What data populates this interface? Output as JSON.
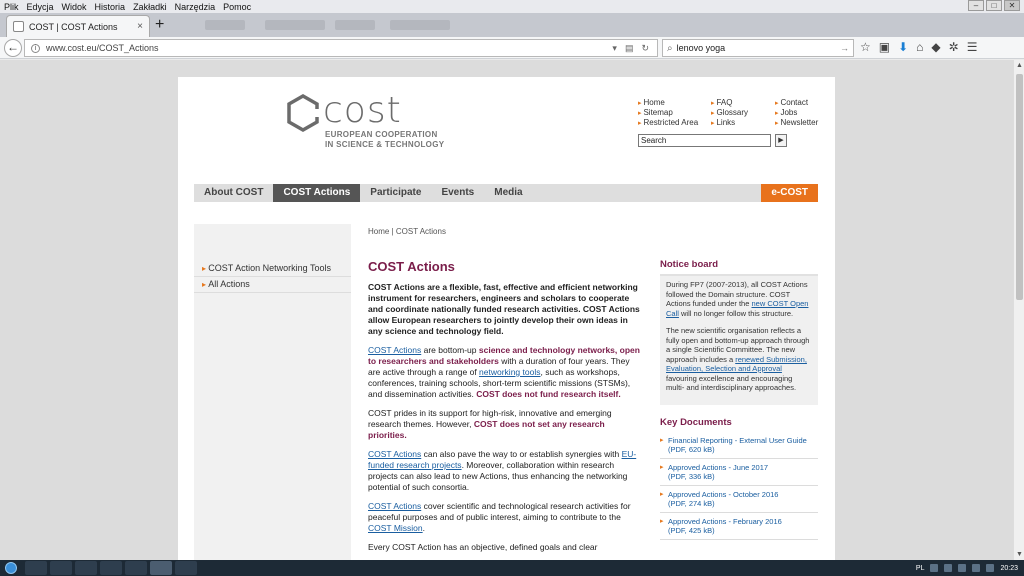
{
  "menubar": {
    "items": [
      "Plik",
      "Edycja",
      "Widok",
      "Historia",
      "Zakładki",
      "Narzędzia",
      "Pomoc"
    ]
  },
  "tab": {
    "title": "COST | COST Actions",
    "close": "×",
    "new_tab": "+"
  },
  "nav": {
    "url": "www.cost.eu/COST_Actions",
    "search_value": "lenovo yoga"
  },
  "site": {
    "logo": {
      "word": "cost",
      "line1": "EUROPEAN COOPERATION",
      "line2": "IN SCIENCE & TECHNOLOGY"
    },
    "top_links": [
      "Home",
      "FAQ",
      "Contact",
      "Sitemap",
      "Glossary",
      "Jobs",
      "Restricted Area",
      "Links",
      "Newsletter"
    ],
    "search_placeholder": "Search",
    "main_nav": [
      "About COST",
      "COST Actions",
      "Participate",
      "Events",
      "Media"
    ],
    "ecost": "e-COST",
    "side_links": [
      "COST Action Networking Tools",
      "All Actions"
    ],
    "breadcrumb": "Home | COST Actions"
  },
  "article": {
    "title": "COST Actions",
    "intro": "COST Actions are a flexible, fast, effective and efficient networking instrument for researchers, engineers and scholars to cooperate and coordinate nationally funded research activities. COST Actions allow European researchers to jointly develop their own ideas in any science and technology field.",
    "p1": {
      "a": "COST Actions",
      "b": " are bottom-up ",
      "c": "science and technology networks, open to researchers and stakeholders",
      "d": " with a duration of four years. They are active through a range of ",
      "e": "networking tools",
      "f": ", such as workshops, conferences, training schools, short-term scientific missions (STSMs), and dissemination activities. ",
      "g": "COST does not fund research itself."
    },
    "p2": {
      "a": "COST prides in its support for high-risk, innovative and emerging research themes. However, ",
      "b": "COST does not set any research priorities."
    },
    "p3": {
      "a": "COST Actions",
      "b": " can also pave the way to or establish synergies with ",
      "c": "EU-funded research projects",
      "d": ". Moreover, collaboration within research projects can also lead to new Actions, thus enhancing the networking potential of such consortia."
    },
    "p4": {
      "a": "COST Actions",
      "b": " cover scientific and technological research activities for peaceful purposes and of public interest, aiming to contribute to the ",
      "c": "COST Mission",
      "d": "."
    },
    "p5": "Every COST Action has an objective, defined goals and clear"
  },
  "notice": {
    "title": "Notice board",
    "n1a": "During FP7 (2007-2013), all COST Actions followed the Domain structure. COST Actions funded under the ",
    "n1b": "new COST Open Call",
    "n1c": " will no longer follow this structure.",
    "n2a": "The new scientific organisation reflects a fully open and bottom-up approach through a single Scientific Committee. The new approach includes a ",
    "n2b": "renewed Submission, Evaluation, Selection and Approval",
    "n2c": " favouring excellence and encouraging multi- and interdisciplinary approaches."
  },
  "key_documents": {
    "title": "Key Documents",
    "items": [
      {
        "title": "Financial Reporting - External User Guide",
        "meta": "(PDF, 620 kB)"
      },
      {
        "title": "Approved Actions - June 2017",
        "meta": "(PDF, 336 kB)"
      },
      {
        "title": "Approved Actions - October 2016",
        "meta": "(PDF, 274 kB)"
      },
      {
        "title": "Approved Actions - February 2016",
        "meta": "(PDF, 425 kB)"
      }
    ]
  },
  "taskbar": {
    "lang": "PL",
    "time": "20:23"
  }
}
